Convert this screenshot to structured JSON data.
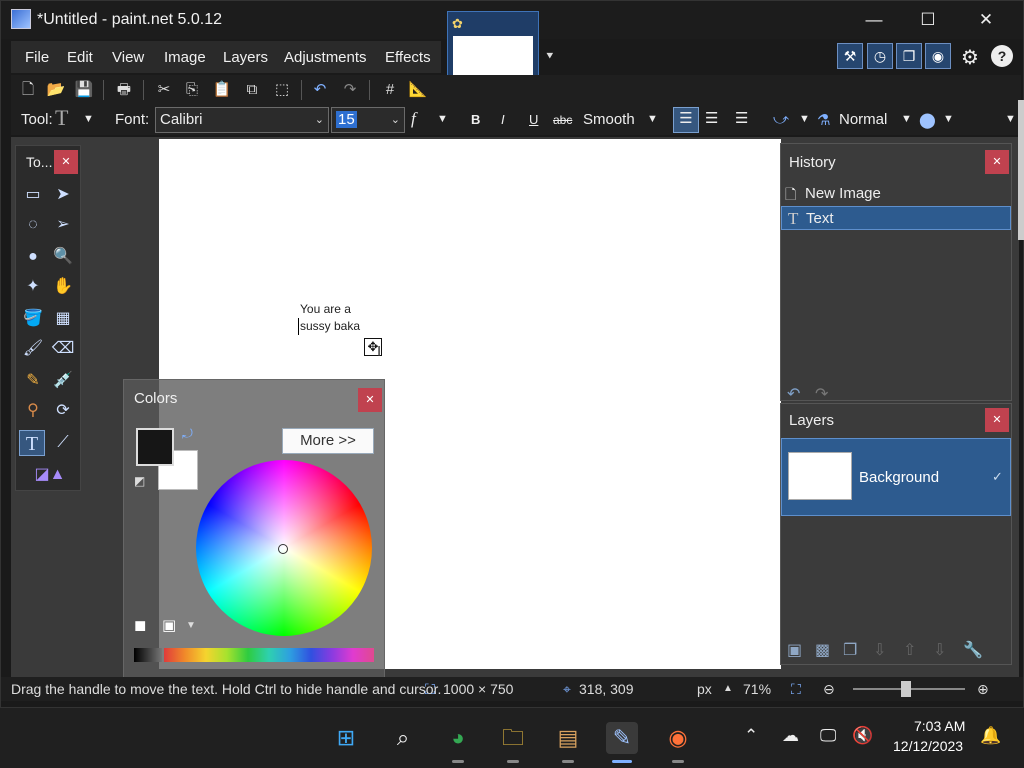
{
  "window": {
    "title": "*Untitled - paint.net 5.0.12",
    "minimize_glyph": "—",
    "maximize_glyph": "☐",
    "close_glyph": "✕"
  },
  "menu": {
    "items": [
      "File",
      "Edit",
      "View",
      "Image",
      "Layers",
      "Adjustments",
      "Effects"
    ]
  },
  "toolbar": {
    "tool_label": "Tool:",
    "font_label": "Font:",
    "font_value": "Calibri",
    "size_value": "15",
    "bold": "B",
    "italic": "I",
    "underline": "U",
    "strikethrough": "abc",
    "antialias": "Smooth",
    "blend_mode": "Normal"
  },
  "canvas": {
    "text_line1": "You are a",
    "text_line2": "sussy baka"
  },
  "tools_panel": {
    "title": "To...",
    "close": "✕"
  },
  "colors_panel": {
    "title": "Colors",
    "more_button": "More >>",
    "close": "✕",
    "primary_color": "#161616",
    "secondary_color": "#ffffff"
  },
  "history_panel": {
    "title": "History",
    "close": "✕",
    "items": [
      {
        "label": "New Image"
      },
      {
        "label": "Text"
      }
    ]
  },
  "layers_panel": {
    "title": "Layers",
    "close": "✕",
    "layer_name": "Background"
  },
  "status": {
    "hint": "Drag the handle to move the text. Hold Ctrl to hide handle and cursor.",
    "image_size": "1000 × 750",
    "cursor_pos": "318, 309",
    "unit": "px",
    "zoom": "71%"
  },
  "taskbar": {
    "time": "7:03 AM",
    "date": "12/12/2023"
  },
  "colors": {
    "accent": "#2d5b8f",
    "close_red": "#c0424f"
  }
}
